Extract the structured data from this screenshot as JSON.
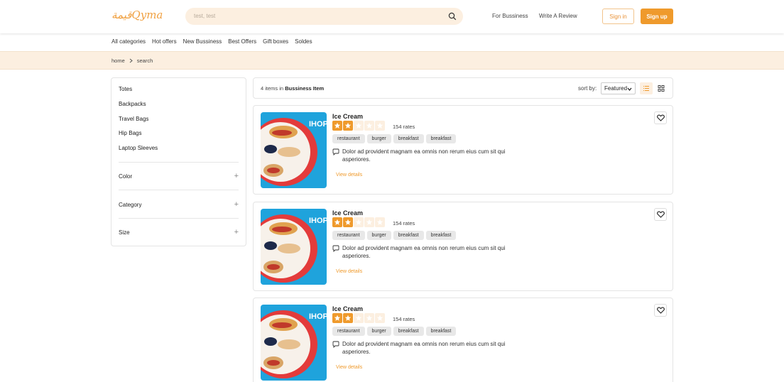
{
  "header": {
    "logo": "قيمةQyma",
    "search_value": "test, test",
    "links": [
      "For Bussiness",
      "Write A Review"
    ],
    "signin_label": "Sign in",
    "signup_label": "Sign up",
    "accent": "#ef9a2c"
  },
  "categories": [
    "All categories",
    "Hot offers",
    "New Bussiness",
    "Best Offers",
    "Gift boxes",
    "Soldes"
  ],
  "breadcrumb": {
    "home": "home",
    "current": "search"
  },
  "sidebar": {
    "items": [
      "Totes",
      "Backpacks",
      "Travel Bags",
      "Hip Bags",
      "Laptop Sleeves"
    ],
    "filters": [
      "Color",
      "Category",
      "Size"
    ]
  },
  "results": {
    "count_text": "4 items in",
    "count_scope": "Bussiness Item",
    "sort_label": "sort by:",
    "sort_value": "Featured"
  },
  "cards": [
    {
      "title": "Ice Cream",
      "rating": 2,
      "max_rating": 5,
      "rates": "154 rates",
      "tags": [
        "restaurant",
        "burger",
        "breakfast",
        "breakfast"
      ],
      "description": "Dolor ad provident magnam ea omnis non rerum eius cum sit qui asperiores.",
      "view_label": "View details"
    },
    {
      "title": "Ice Cream",
      "rating": 2,
      "max_rating": 5,
      "rates": "154 rates",
      "tags": [
        "restaurant",
        "burger",
        "breakfast",
        "breakfast"
      ],
      "description": "Dolor ad provident magnam ea omnis non rerum eius cum sit qui asperiores.",
      "view_label": "View details"
    },
    {
      "title": "Ice Cream",
      "rating": 2,
      "max_rating": 5,
      "rates": "154 rates",
      "tags": [
        "restaurant",
        "burger",
        "breakfast",
        "breakfast"
      ],
      "description": "Dolor ad provident magnam ea omnis non rerum eius cum sit qui asperiores.",
      "view_label": "View details"
    }
  ],
  "thumb_brand": "IHOP"
}
